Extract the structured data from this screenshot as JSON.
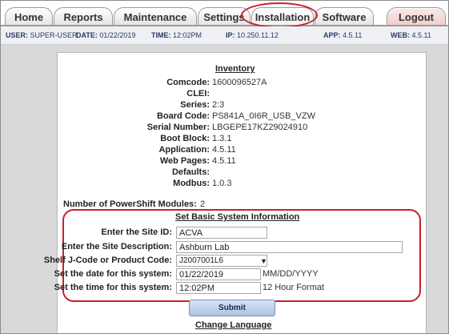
{
  "tabs": [
    {
      "label": "Home"
    },
    {
      "label": "Reports"
    },
    {
      "label": "Maintenance"
    },
    {
      "label": "Settings"
    },
    {
      "label": "Installation"
    },
    {
      "label": "Software"
    },
    {
      "label": "Logout"
    }
  ],
  "status": {
    "user_label": "USER:",
    "user_value": "SUPER-USER",
    "date_label": "DATE:",
    "date_value": "01/22/2019",
    "time_label": "TIME:",
    "time_value": "12:02PM",
    "ip_label": "IP:",
    "ip_value": "10.250.11.12",
    "app_label": "APP:",
    "app_value": "4.5.11",
    "web_label": "WEB:",
    "web_value": "4.5.11"
  },
  "inventory": {
    "title": "Inventory",
    "rows": [
      {
        "label": "Comcode:",
        "value": "1600096527A"
      },
      {
        "label": "CLEI:",
        "value": ""
      },
      {
        "label": "Series:",
        "value": "2:3"
      },
      {
        "label": "Board Code:",
        "value": "PS841A_0I6R_USB_VZW"
      },
      {
        "label": "Serial Number:",
        "value": "LBGEPE17KZ29024910"
      },
      {
        "label": "Boot Block:",
        "value": "1.3.1"
      },
      {
        "label": "Application:",
        "value": "4.5.11"
      },
      {
        "label": "Web Pages:",
        "value": "4.5.11"
      },
      {
        "label": "Defaults:",
        "value": ""
      },
      {
        "label": "Modbus:",
        "value": "1.0.3"
      }
    ],
    "modules_label": "Number of PowerShift Modules:",
    "modules_value": "2"
  },
  "basic_info": {
    "title": "Set Basic System Information",
    "site_id_label": "Enter the Site ID:",
    "site_id_value": "ACVA",
    "site_desc_label": "Enter the Site Description:",
    "site_desc_value": "Ashburn Lab",
    "shelf_label": "Shelf J-Code or Product Code:",
    "shelf_value": "J2007001L6",
    "date_label": "Set the date for this system:",
    "date_value": "01/22/2019",
    "date_hint": "MM/DD/YYYY",
    "time_label": "Set the time for this system:",
    "time_value": "12:02PM",
    "time_hint": "12 Hour Format",
    "submit_label": "Submit"
  },
  "change_language": {
    "title": "Change Language"
  },
  "colors": {
    "highlight": "#cc1f2a",
    "status_text": "#2b3a66"
  }
}
